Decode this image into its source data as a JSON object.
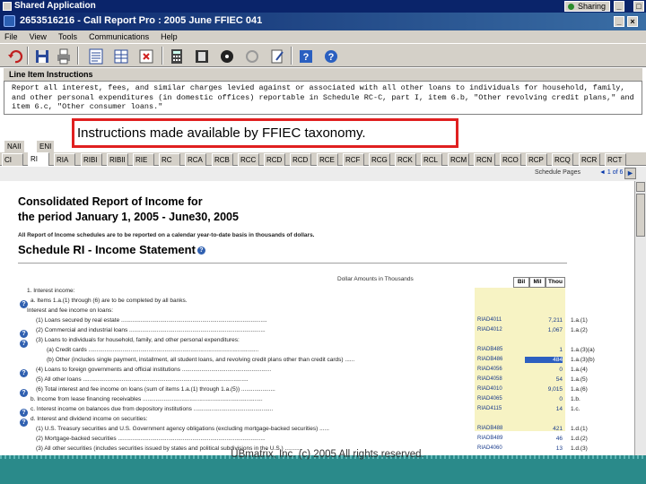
{
  "shared_app": {
    "title": "Shared Application",
    "sharing_label": "Sharing",
    "buttons": [
      "_",
      "□",
      "×"
    ]
  },
  "window": {
    "title": "2653516216 - Call Report Pro : 2005 June FFIEC 041"
  },
  "menu": {
    "items": [
      "File",
      "View",
      "Tools",
      "Communications",
      "Help"
    ]
  },
  "toolbar": {
    "icons": [
      "undo-icon",
      "save-icon",
      "print-icon",
      "report-icon",
      "table-icon",
      "delete-icon",
      "calculator-icon",
      "film-icon",
      "disc-icon",
      "refresh-icon",
      "edit-icon",
      "help-icon",
      "info-icon"
    ]
  },
  "instructions": {
    "header": "Line Item Instructions",
    "text": "Report all interest, fees, and similar charges levied against or associated with all other loans to individuals for household, family,\nand other personal expenditures (in domestic offices) reportable in Schedule RC-C, part I, item 6.b, \"Other revolving credit plans,\" and\nitem 6.c, \"Other consumer loans.\""
  },
  "callout": {
    "text": "Instructions made available by FFIEC taxonomy."
  },
  "tabs_top": [
    "NAII",
    "ENI"
  ],
  "tabs": [
    "CI",
    "RI",
    "RIA",
    "RIBI",
    "RIBII",
    "RIE",
    "RC",
    "RCA",
    "RCB",
    "RCC",
    "RCD",
    "RCD",
    "RCE",
    "RCF",
    "RCG",
    "RCK",
    "RCL",
    "RCM",
    "RCN",
    "RCO",
    "RCP",
    "RCQ",
    "RCR",
    "RCT"
  ],
  "active_tab_index": 1,
  "nav": {
    "link": "Schedule Pages",
    "arrows": "◄ 1 of 6 ►"
  },
  "report": {
    "title_line1": "Consolidated Report of Income for",
    "title_line2": "the period January 1, 2005 - June30, 2005",
    "subtitle": "All Report of Income schedules are to be reported on a calendar year-to-date basis in thousands of dollars.",
    "schedule": "Schedule RI - Income Statement",
    "dollar_header": "Dollar Amounts in Thousands",
    "columns": [
      "Bil",
      "Mil",
      "Thou"
    ],
    "rows": [
      {
        "help": false,
        "label": "1. Interest income:",
        "code": "",
        "value": "",
        "ref": ""
      },
      {
        "help": true,
        "label": "a. Items 1.a.(1) through (6) are to be completed by all banks.",
        "code": "",
        "value": "",
        "ref": ""
      },
      {
        "help": false,
        "label": "Interest and fee income on loans:",
        "code": "",
        "value": "",
        "ref": ""
      },
      {
        "help": false,
        "label": "(1) Loans secured by real estate ..........................................................................................",
        "code": "RIAD4011",
        "value": "7,211",
        "ref": "1.a.(1)"
      },
      {
        "help": true,
        "label": "(2) Commercial and industrial loans ....................................................................................",
        "code": "RIAD4012",
        "value": "1,067",
        "ref": "1.a.(2)"
      },
      {
        "help": true,
        "label": "(3) Loans to individuals for household, family, and other personal expenditures:",
        "code": "",
        "value": "",
        "ref": ""
      },
      {
        "help": false,
        "label": "(a) Credit cards .........................................................................................................",
        "code": "RIADB485",
        "value": "1",
        "ref": "1.a.(3)(a)"
      },
      {
        "help": false,
        "label": "(b) Other (includes single payment, installment, all student loans, and revolving credit plans other than credit cards) ......",
        "code": "RIADB486",
        "value": "484",
        "ref": "1.a.(3)(b)",
        "highlight": true
      },
      {
        "help": true,
        "label": "(4) Loans to foreign governments and official institutions .......................................................",
        "code": "RIAD4056",
        "value": "0",
        "ref": "1.a.(4)"
      },
      {
        "help": false,
        "label": "(5) All other loans ......................................................................................................",
        "code": "RIAD4058",
        "value": "54",
        "ref": "1.a.(5)"
      },
      {
        "help": true,
        "label": "(6) Total interest and fee income on loans (sum of items 1.a.(1) through 1.a.(5)) .....................",
        "code": "RIAD4010",
        "value": "9,015",
        "ref": "1.a.(6)"
      },
      {
        "help": false,
        "label": "b. Income from lease financing receivables ..........................................................................",
        "code": "RIAD4065",
        "value": "0",
        "ref": "1.b."
      },
      {
        "help": true,
        "label": "c. Interest income on balances due from depository institutions .................................................",
        "code": "RIAD4115",
        "value": "14",
        "ref": "1.c."
      },
      {
        "help": true,
        "label": "d. Interest and dividend income on securities:",
        "code": "",
        "value": "",
        "ref": ""
      },
      {
        "help": false,
        "label": "(1) U.S. Treasury securities and U.S. Government agency obligations (excluding mortgage-backed securities) ......",
        "code": "RIADB488",
        "value": "421",
        "ref": "1.d.(1)"
      },
      {
        "help": false,
        "label": "(2) Mortgage-backed securities ...........................................................................................",
        "code": "RIADB489",
        "value": "46",
        "ref": "1.d.(2)"
      },
      {
        "help": false,
        "label": "(3) All other securities (includes securities issued by states and political subdivisions in the U.S.) ...........",
        "code": "RIAD4060",
        "value": "13",
        "ref": "1.d.(3)"
      }
    ]
  },
  "footer": {
    "copyright": "UBmatrix, Inc. (c) 2005 All rights reserved."
  }
}
